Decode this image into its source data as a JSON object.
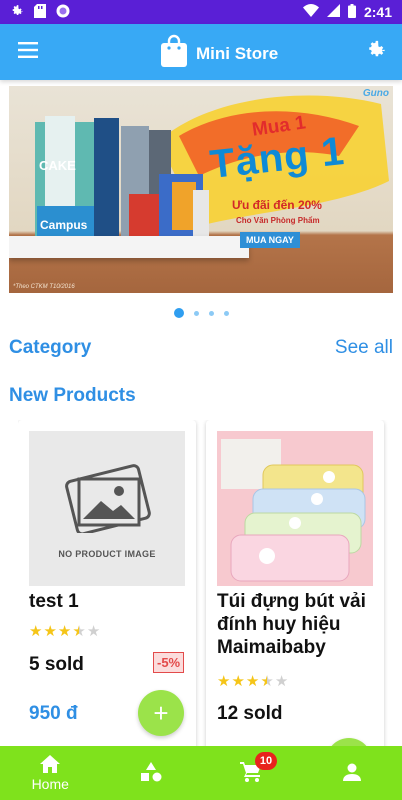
{
  "status_bar": {
    "time": "2:41",
    "left_icons": [
      "gear-icon",
      "sd-card-icon",
      "circle-app-icon"
    ],
    "right_icons": [
      "wifi-icon",
      "signal-icon",
      "battery-icon"
    ]
  },
  "app_bar": {
    "title": "Mini Store",
    "menu_icon": "hamburger-menu-icon",
    "logo_icon": "shopping-bag-icon",
    "settings_icon": "gear-icon",
    "background": "#38a9f5"
  },
  "banner": {
    "promo_line1": "Mua 1",
    "promo_line2": "Tặng 1",
    "promo_line3": "Ưu đãi đến 20%",
    "promo_line4": "Cho Văn Phòng Phẩm",
    "cta": "MUA NGAY",
    "note": "*Theo CTKM T10/2016",
    "logo": "Guno",
    "product_labels": [
      "CAKE",
      "Campus"
    ],
    "dots_count": 4,
    "active_dot": 0
  },
  "category_section": {
    "title": "Category",
    "see_all": "See all"
  },
  "new_products_section": {
    "title": "New Products"
  },
  "products": [
    {
      "no_image_text": "NO PRODUCT IMAGE",
      "name": "test 1",
      "rating": 3.5,
      "rating_max": 5,
      "sold": "5 sold",
      "discount": "-5%",
      "price": "950 đ"
    },
    {
      "name": "Túi đựng bút vải đính huy hiệu Maimaibaby",
      "rating": 3.5,
      "rating_max": 5,
      "sold": "12 sold"
    }
  ],
  "bottom_nav": {
    "items": [
      {
        "icon": "home-icon",
        "label": "Home"
      },
      {
        "icon": "shapes-category-icon",
        "label": ""
      },
      {
        "icon": "cart-icon",
        "label": "",
        "badge": "10"
      },
      {
        "icon": "person-icon",
        "label": ""
      }
    ],
    "background": "#7fe21c"
  }
}
